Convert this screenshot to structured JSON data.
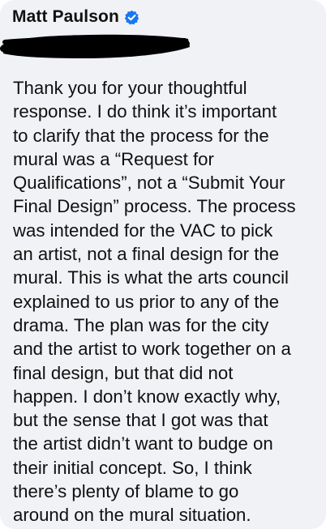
{
  "comment": {
    "author": "Matt Paulson",
    "verified": true,
    "icons": {
      "verified_badge": "verified-badge-icon",
      "redaction": "redaction-scribble"
    },
    "colors": {
      "bubble_background": "#f0f2f5",
      "verified_badge": "#1877f2",
      "redaction": "#000000",
      "text": "#111111"
    },
    "body": "Thank you for your thoughtful\nresponse. I do think it’s important\nto clarify that the process for the\nmural was a “Request for\nQualifications”, not a “Submit Your\nFinal Design” process. The process\nwas intended for the VAC to pick\nan artist, not a final design for the\nmural. This is what the arts council\nexplained to us prior to any of the\ndrama. The plan was for the city\nand the artist to work together on a\nfinal design, but that did not\nhappen. I don’t know exactly why,\nbut the sense that I got was that\nthe artist didn’t want to budge on\ntheir initial concept. So, I think\nthere’s plenty of blame to go\naround on the mural situation."
  }
}
